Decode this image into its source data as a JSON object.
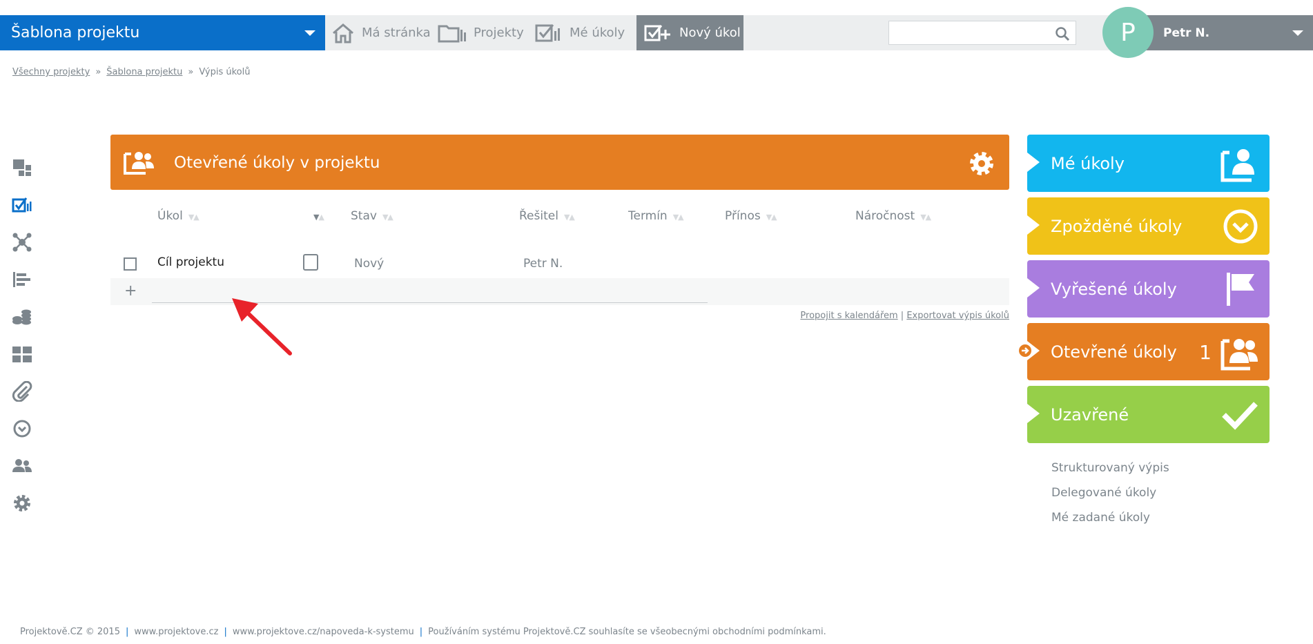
{
  "topbar": {
    "project_select": "Šablona projektu",
    "nav": {
      "home": "Má stránka",
      "projects": "Projekty",
      "my_tasks": "Mé úkoly",
      "new_task": "Nový úkol"
    },
    "search_placeholder": "",
    "user": {
      "initial": "P",
      "name": "Petr N."
    }
  },
  "breadcrumb": {
    "items": [
      "Všechny projekty",
      "Šablona projektu",
      "Výpis úkolů"
    ],
    "separator": "»"
  },
  "leftnav": {
    "icons": [
      "dashboard-icon",
      "tasks-icon",
      "network-icon",
      "gantt-icon",
      "coins-icon",
      "tiles-icon",
      "attachment-icon",
      "clock-icon",
      "users-icon",
      "settings-icon"
    ],
    "active": "tasks-icon"
  },
  "panel": {
    "title": "Otevřené úkoly v projektu",
    "color": "#e57e22",
    "columns": {
      "task": "Úkol",
      "status": "Stav",
      "assignee": "Řešitel",
      "deadline": "Termín",
      "benefit": "Přínos",
      "effort": "Náročnost"
    },
    "rows": [
      {
        "task": "Cíl projektu",
        "status": "Nový",
        "assignee": "Petr N."
      }
    ],
    "add_placeholder": "",
    "links": {
      "calendar": "Propojit s kalendářem",
      "separator": "|",
      "export": "Exportovat výpis úkolů"
    }
  },
  "tiles": [
    {
      "label": "Mé úkoly",
      "color": "#12b6ee",
      "icon": "person-board-icon"
    },
    {
      "label": "Zpožděné úkoly",
      "color": "#f0c218",
      "icon": "clock-down-icon"
    },
    {
      "label": "Vyřešené úkoly",
      "color": "#a97ddf",
      "icon": "flag-icon"
    },
    {
      "label": "Otevřené úkoly",
      "color": "#e57e22",
      "icon": "people-board-icon",
      "count": "1"
    },
    {
      "label": "Uzavřené",
      "color": "#96cf49",
      "icon": "check-icon"
    }
  ],
  "right_links": [
    "Strukturovaný výpis",
    "Delegované úkoly",
    "Mé zadané úkoly"
  ],
  "footer": {
    "copyright": "Projektově.CZ © 2015",
    "site": "www.projektove.cz",
    "help": "www.projektove.cz/napoveda-k-systemu",
    "terms": "Používáním systému Projektově.CZ souhlasíte se všeobecnými obchodními podmínkami.",
    "separator": "|"
  }
}
